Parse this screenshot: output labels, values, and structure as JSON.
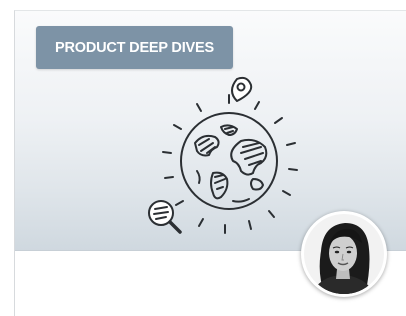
{
  "card": {
    "tag_label": "PRODUCT DEEP DIVES",
    "colors": {
      "tag_background": "#7d93a6",
      "hero_gradient_top": "#fafbfc",
      "hero_gradient_bottom": "#cfd8df"
    },
    "illustration": "globe-with-map-pin-and-magnifier",
    "avatar": "author-avatar"
  }
}
